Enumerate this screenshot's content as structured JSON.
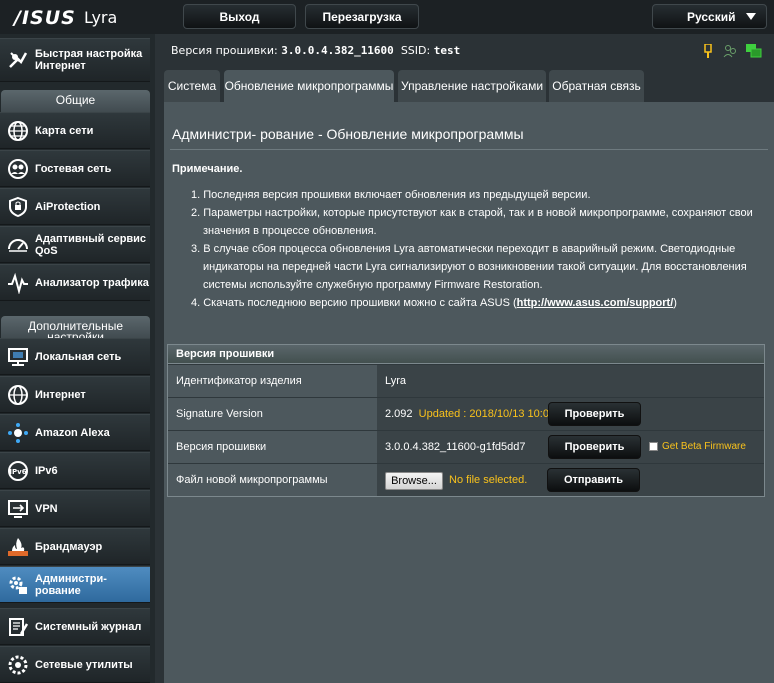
{
  "header": {
    "logo": "/ISUS",
    "model": "Lyra",
    "logout_label": "Выход",
    "reboot_label": "Перезагрузка",
    "language": "Русский"
  },
  "sidebar": {
    "quick_setup": "Быстрая настройка Интернет",
    "general_header": "Общие",
    "general_items": [
      {
        "label": "Карта сети",
        "icon": "network-map-icon"
      },
      {
        "label": "Гостевая сеть",
        "icon": "guest-network-icon"
      },
      {
        "label": "AiProtection",
        "icon": "shield-icon"
      },
      {
        "label": "Адаптивный сервис QoS",
        "icon": "gauge-icon"
      },
      {
        "label": "Анализатор трафика",
        "icon": "traffic-icon"
      }
    ],
    "advanced_header": "Дополнительные настройки",
    "advanced_items": [
      {
        "label": "Локальная сеть",
        "icon": "lan-icon"
      },
      {
        "label": "Интернет",
        "icon": "globe-icon"
      },
      {
        "label": "Amazon Alexa",
        "icon": "alexa-icon"
      },
      {
        "label": "IPv6",
        "icon": "ipv6-icon"
      },
      {
        "label": "VPN",
        "icon": "vpn-icon"
      },
      {
        "label": "Брандмауэр",
        "icon": "firewall-icon"
      },
      {
        "label": "Администри- рование",
        "icon": "admin-gear-icon"
      },
      {
        "label": "Системный журнал",
        "icon": "syslog-icon"
      },
      {
        "label": "Сетевые утилиты",
        "icon": "network-tools-icon"
      }
    ],
    "active_item": "Администри- рование"
  },
  "status": {
    "firmware_label": "Версия прошивки:",
    "firmware_value": "3.0.0.4.382_11600",
    "ssid_label": "SSID:",
    "ssid_value": "test"
  },
  "tabs": [
    {
      "label": "Система",
      "active": false
    },
    {
      "label": "Обновление микропрограммы",
      "active": true
    },
    {
      "label": "Управление настройками",
      "active": false
    },
    {
      "label": "Обратная связь",
      "active": false
    }
  ],
  "main": {
    "title": "Администри- рование - Обновление микропрограммы",
    "note_title": "Примечание.",
    "notes": [
      "1. Последняя версия прошивки включает обновления из предыдущей версии.",
      "2. Параметры настройки, которые присутствуют как в старой, так и в новой микропрограмме, сохраняют свои значения в процессе обновления.",
      "3. В случае сбоя процесса обновления Lyra автоматически переходит в аварийный режим. Светодиодные индикаторы на передней части Lyra сигнализируют о возникновении такой ситуации. Для восстановления системы используйте служебную программу Firmware Restoration.",
      "4. Скачать последнюю версию прошивки можно с сайта ASUS ("
    ],
    "note4_link": "http://www.asus.com/support/",
    "note4_end": ")",
    "table_header": "Версия прошивки",
    "rows": {
      "product_id_label": "Идентификатор изделия",
      "product_id_value": "Lyra",
      "signature_label": "Signature Version",
      "signature_value": "2.092",
      "signature_updated": "Updated : 2018/10/13 10:07",
      "check_label": "Проверить",
      "firmware_label": "Версия прошивки",
      "firmware_value": "3.0.0.4.382_11600-g1fd5dd7",
      "beta_label": "Get Beta Firmware",
      "file_label": "Файл новой микропрограммы",
      "browse_label": "Browse...",
      "no_file": "No file selected.",
      "upload_label": "Отправить"
    }
  },
  "colors": {
    "accent_yellow": "#f9c21c",
    "active_blue": "#3f7db1",
    "status_green": "#3fd03f"
  }
}
